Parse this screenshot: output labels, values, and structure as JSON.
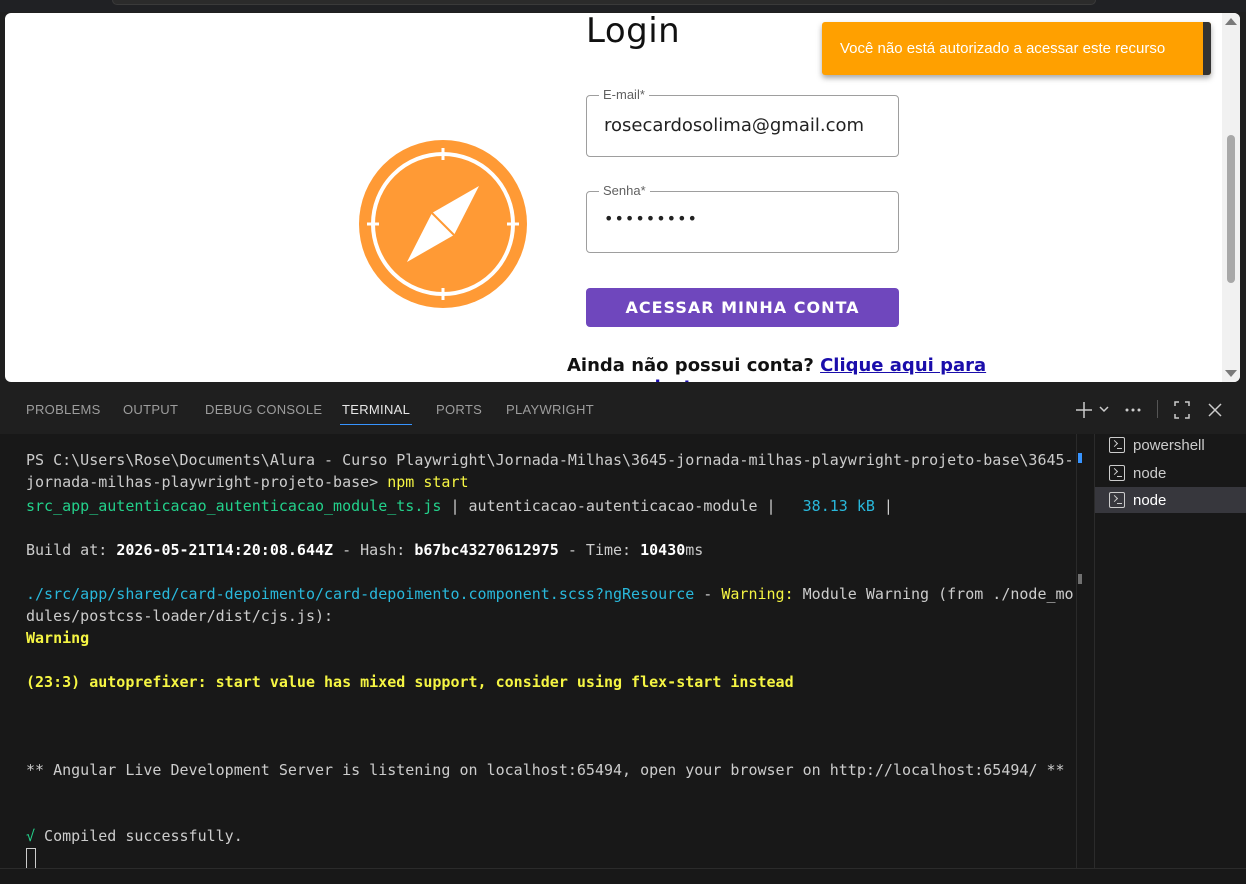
{
  "preview": {
    "login_title": "Login",
    "email_label": "E-mail*",
    "email_value": "rosecardosolima@gmail.com",
    "password_label": "Senha*",
    "password_value": "•••••••••",
    "submit_label": "ACESSAR MINHA CONTA",
    "signup_prompt": "Ainda não possui conta?",
    "signup_link_1": "Clique aqui para",
    "signup_link_2": "cadastrar",
    "toast_message": "Você não está autorizado a acessar este recurso",
    "accent": "#ff9a35",
    "button_color": "#6f47bd",
    "toast_color": "#ffa000"
  },
  "panel": {
    "tabs": [
      "PROBLEMS",
      "OUTPUT",
      "DEBUG CONSOLE",
      "TERMINAL",
      "PORTS",
      "PLAYWRIGHT"
    ],
    "active_tab": "TERMINAL",
    "actions": [
      "plus-icon",
      "chevron-down-icon",
      "more-icon",
      "maximize-icon",
      "close-icon"
    ]
  },
  "terminal": {
    "prompt_line_1": "PS C:\\Users\\Rose\\Documents\\Alura - Curso Playwright\\Jornada-Milhas\\3645-jornada-milhas-playwright-projeto-base\\3645-",
    "prompt_line_2a": "jornada-milhas-playwright-projeto-base> ",
    "prompt_cmd": "npm start",
    "chunk_file": "src_app_autenticacao_autenticacao_module_ts.js",
    "chunk_sep1": " | ",
    "chunk_name": "autenticacao-autenticacao-module",
    "chunk_sep2": " | ",
    "chunk_size": "  38.13 kB",
    "chunk_sep3": " |",
    "build_prefix": "Build at: ",
    "build_time": "2026-05-21T14:20:08.644Z",
    "hash_prefix": " - Hash: ",
    "hash": "b67bc43270612975",
    "time_prefix": " - Time: ",
    "time_value": "10430",
    "time_unit": "ms",
    "warn_path": "./src/app/shared/card-depoimento/card-depoimento.component.scss?ngResource",
    "warn_dash": " - ",
    "warn_label": "Warning:",
    "warn_text_1": " Module Warning (from ./node_mo",
    "warn_text_2": "dules/postcss-loader/dist/cjs.js):",
    "warning_word": "Warning",
    "autoprefixer": "(23:3) autoprefixer: start value has mixed support, consider using flex-start instead",
    "server_msg": "** Angular Live Development Server is listening on localhost:65494, open your browser on http://localhost:65494/ **",
    "check": "√",
    "compiled": " Compiled successfully."
  },
  "sessions": {
    "items": [
      "powershell",
      "node",
      "node"
    ],
    "active_index": 2
  }
}
